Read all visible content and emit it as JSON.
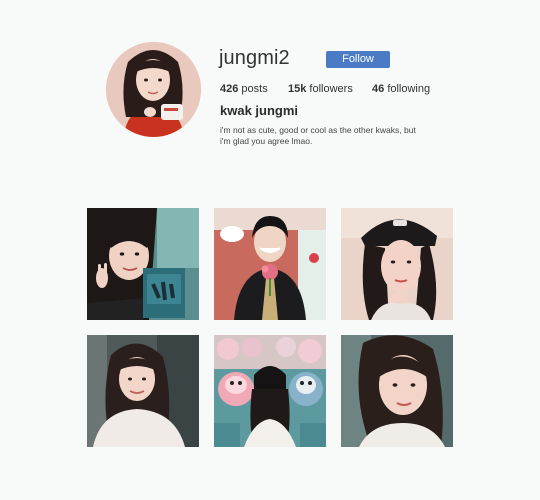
{
  "profile": {
    "username": "jungmi2",
    "follow_label": "Follow",
    "stats": {
      "posts_num": "426",
      "posts_label": "posts",
      "followers_num": "15k",
      "followers_label": "followers",
      "following_num": "46",
      "following_label": "following"
    },
    "full_name": "kwak jungmi",
    "bio_line1": "i'm not as cute, good or cool as the other kwaks, but",
    "bio_line2": "i'm glad you agree lmao."
  },
  "colors": {
    "follow_button": "#4a7bc4",
    "background": "#f8f9f9"
  },
  "posts": [
    {
      "name": "post-1",
      "subject": "girl with album peace sign"
    },
    {
      "name": "post-2",
      "subject": "boy with flower"
    },
    {
      "name": "post-3",
      "subject": "girl in black cap"
    },
    {
      "name": "post-4",
      "subject": "girl in white hoodie"
    },
    {
      "name": "post-5",
      "subject": "girl with plush toys"
    },
    {
      "name": "post-6",
      "subject": "girl selfie close-up"
    }
  ]
}
